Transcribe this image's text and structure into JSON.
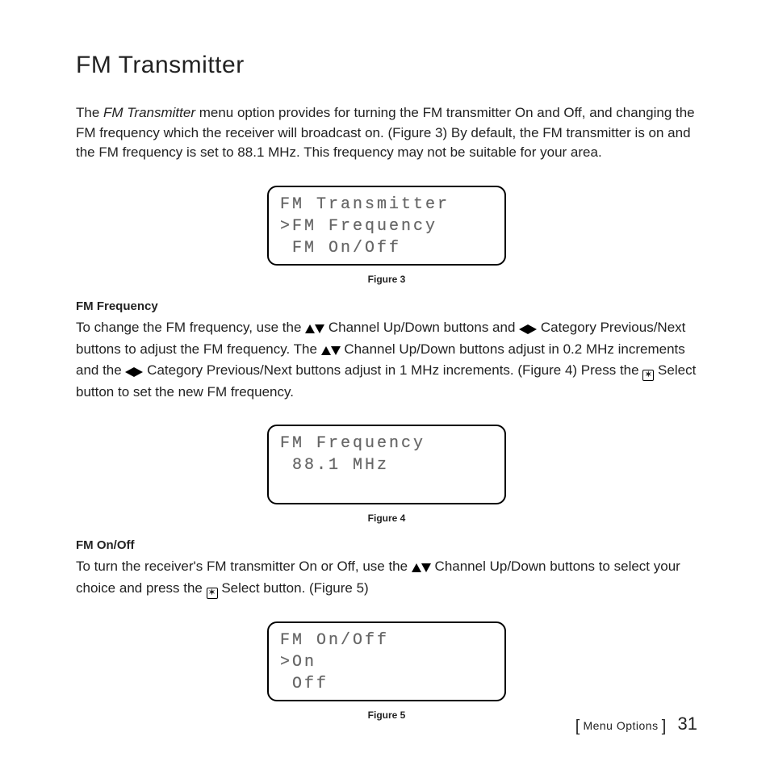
{
  "title": "FM Transmitter",
  "intro": {
    "prefix": "The ",
    "italic": "FM Transmitter",
    "rest": " menu option provides for turning the FM transmitter On and Off, and changing the FM frequency which the receiver will broadcast on. (Figure 3) By default, the FM transmitter is on and the FM frequency is set to 88.1 MHz. This frequency may not be suitable for your area."
  },
  "fig3": {
    "caption": "Figure 3",
    "l1": "FM Transmitter",
    "l2": ">FM Frequency",
    "l3": " FM On/Off"
  },
  "fmFreq": {
    "heading": "FM Frequency",
    "t1": "To change the FM frequency, use the ",
    "t2": " Channel Up/Down buttons and ",
    "t3": " Category Previous/Next buttons to adjust the FM frequency. The ",
    "t4": " Channel Up/Down buttons adjust in 0.2 MHz increments and the ",
    "t5": " Category Previous/Next buttons adjust in 1 MHz increments. (Figure 4) Press the ",
    "t6": " Select button to set the new FM frequency."
  },
  "fig4": {
    "caption": "Figure 4",
    "l1": "FM Frequency",
    "l2": " 88.1 MHz",
    "l3": " "
  },
  "fmOnOff": {
    "heading": "FM On/Off",
    "t1": "To turn the receiver's FM transmitter On or Off, use the ",
    "t2": " Channel Up/Down buttons to select your choice and press the ",
    "t3": " Select button. (Figure 5)"
  },
  "fig5": {
    "caption": "Figure 5",
    "l1": "FM On/Off",
    "l2": ">On",
    "l3": " Off"
  },
  "footer": {
    "section": "Menu Options",
    "page": "31"
  }
}
